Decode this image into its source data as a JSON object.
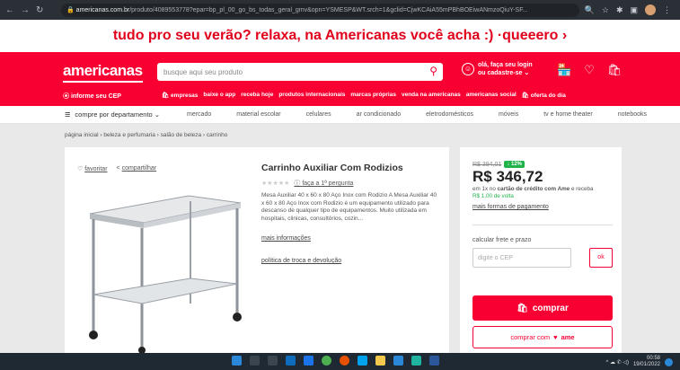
{
  "browser": {
    "url_host": "americanas.com.br",
    "url_path": "/produto/4089553778?epar=bp_pl_00_go_bs_todas_geral_gmv&opn=YSMESP&WT.srch=1&gclid=CjwKCAiA55mPBhBOEiwANmzoQiuY-SF..."
  },
  "promo": {
    "text": "tudo pro seu verão? relaxa, na Americanas você acha :) · ",
    "link": "queeero ›"
  },
  "header": {
    "logo": "americanas",
    "search_placeholder": "busque aqui seu produto",
    "login_line1": "olá, faça seu login",
    "login_line2": "ou cadastre-se ⌄",
    "cep": "⦿ informe seu CEP",
    "links": [
      "🛍 empresas",
      "baixe o app",
      "receba hoje",
      "produtos internacionais",
      "marcas próprias",
      "venda na americanas",
      "americanas social",
      "🛍 oferta do dia"
    ]
  },
  "catbar": {
    "dept": "compre por departamento ⌄",
    "items": [
      "mercado",
      "material escolar",
      "celulares",
      "ar condicionado",
      "eletrodomésticos",
      "móveis",
      "tv e home theater",
      "notebooks"
    ]
  },
  "breadcrumb": "página inicial  ›  beleza e perfumaria  ›  salão de beleza  ›  carrinho",
  "product": {
    "fav": "favoritar",
    "share": "compartilhar",
    "title": "Carrinho Auxiliar Com Rodizios",
    "question": "faça a 1ª pergunta",
    "description": "Mesa Auxiliar 40 x 60 x 80 Aço Inox com Rodizio A Mesa Auxiliar 40 x 60 x 80 Aço Inox com Rodizio é um equipamento utilizado para descanso de qualquer tipo de equipamentos. Muito utilizada em hospitais, clinicas, consultórios, cozin...",
    "more": "mais informações",
    "policy": "política de troca e devolução"
  },
  "buy": {
    "old_price": "R$ 394,01",
    "discount": "↓ 12%",
    "price": "R$ 346,72",
    "cond1": "em 1x no ",
    "cond_bold": "cartão de crédito com Ame",
    "cond2": " e receba",
    "cashback": "R$ 1,00 de volta",
    "pay": "mais formas de pagamento",
    "frete": "calcular frete e prazo",
    "cep_placeholder": "digite o CEP",
    "ok": "ok",
    "buy_label": "comprar",
    "ame_label": "comprar com",
    "ame_brand": "ame"
  },
  "taskbar": {
    "time": "00:58",
    "date": "19/01/2022"
  }
}
